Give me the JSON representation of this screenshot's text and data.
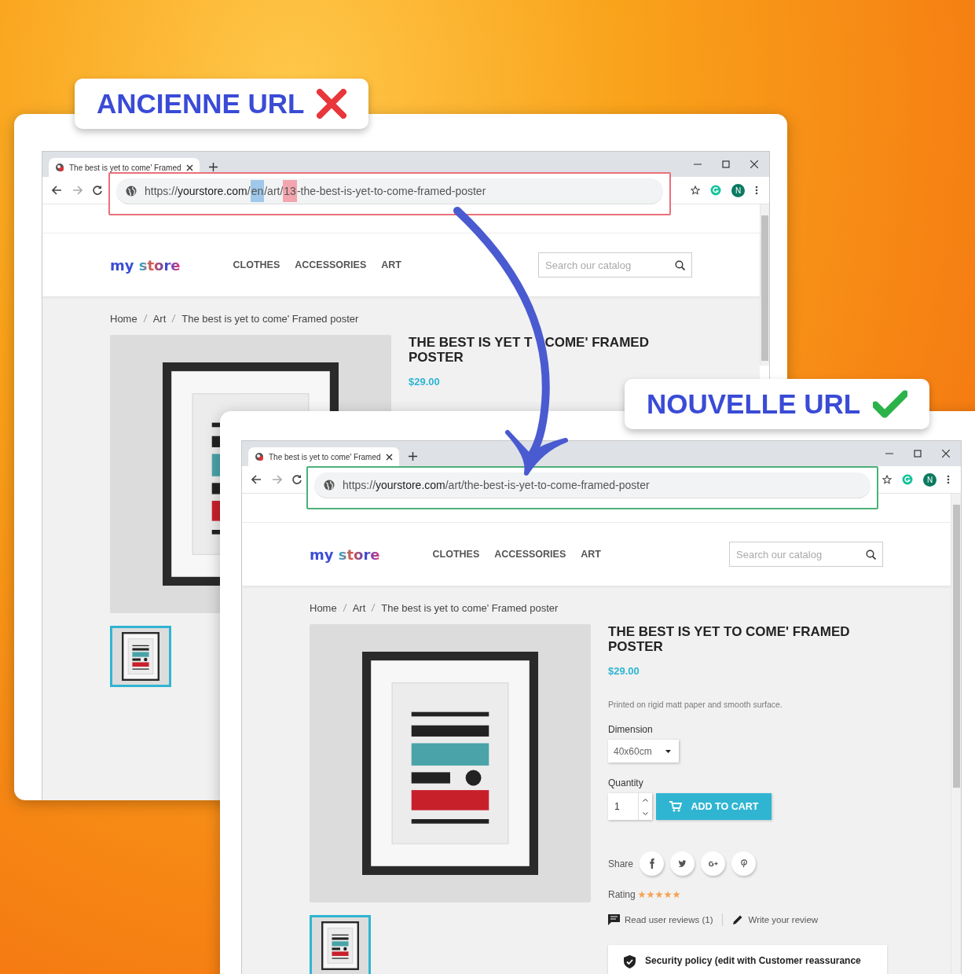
{
  "labels": [
    {
      "kind": "wrong",
      "text": "ANCIENNE URL"
    },
    {
      "kind": "right",
      "text": "NOUVELLE URL"
    }
  ],
  "browsers": [
    {
      "kind": "old",
      "tab_title": "The best is yet to come' Framed",
      "address": [
        {
          "text": "https://"
        },
        {
          "text": "yourstore.com",
          "kind": "domain"
        },
        {
          "text": "/"
        },
        {
          "text": "en",
          "color": "#9fc8ea"
        },
        {
          "text": "/art/"
        },
        {
          "text": "13",
          "color": "#f2a5ad"
        },
        {
          "text": "-the-best-is-yet-to-come-framed-poster"
        }
      ],
      "profile_initial": "N",
      "logo": "my store",
      "nav": [
        "CLOTHES",
        "ACCESSORIES",
        "ART"
      ],
      "search_placeholder": "Search our catalog",
      "breadcrumb": [
        "Home",
        "Art",
        "The best is yet to come' Framed poster"
      ],
      "product": {
        "title_parts": [
          "THE BEST IS YET T",
          "COME' FRAMED",
          "POSTER"
        ],
        "price": "$29.00"
      }
    },
    {
      "kind": "new",
      "tab_title": "The best is yet to come' Framed",
      "address": [
        {
          "text": "https://"
        },
        {
          "text": "yourstore.com",
          "kind": "domain"
        },
        {
          "text": "/art/the-best-is-yet-to-come-framed-poster"
        }
      ],
      "profile_initial": "N",
      "logo": "my store",
      "nav": [
        "CLOTHES",
        "ACCESSORIES",
        "ART"
      ],
      "search_placeholder": "Search our catalog",
      "breadcrumb": [
        "Home",
        "Art",
        "The best is yet to come' Framed poster"
      ],
      "product": {
        "title": "THE BEST IS YET TO COME' FRAMED POSTER",
        "price": "$29.00",
        "description": "Printed on rigid matt paper and smooth surface.",
        "dimension_label": "Dimension",
        "dimension_value": "40x60cm",
        "quantity_label": "Quantity",
        "quantity_value": "1",
        "add_to_cart": "ADD TO CART",
        "share_label": "Share",
        "rating_label": "Rating",
        "stars": 5,
        "read_reviews": "Read user reviews (1)",
        "write_review": "Write your review",
        "reassurance": "Security policy (edit with Customer reassurance"
      }
    }
  ]
}
